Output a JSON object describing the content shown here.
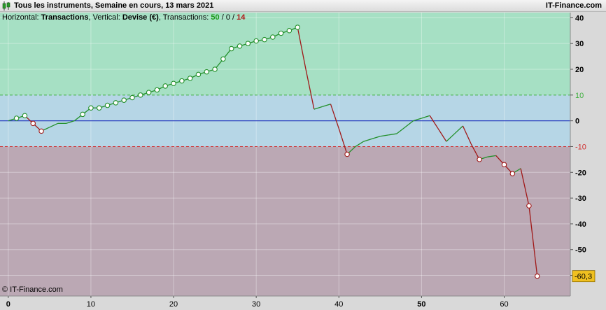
{
  "header": {
    "title": "Tous les instruments, Semaine en cours, 13 mars 2021",
    "brand": "IT-Finance.com"
  },
  "subtitle": {
    "horizontal_label": "Horizontal:",
    "horizontal_value": "Transactions",
    "vertical_label": "Vertical:",
    "vertical_value": "Devise (€)",
    "transactions_label": "Transactions:",
    "count_win": "50",
    "count_neutral": "0",
    "count_loss": "14",
    "sep": "/"
  },
  "footer": {
    "credit": "© IT-Finance.com"
  },
  "colors": {
    "profit_zone": "#a6e0c4",
    "neutral_zone": "#b6d6e6",
    "loss_zone": "#bba8b4",
    "win_line": "#22902a",
    "loss_line": "#a01818",
    "zero_line": "#2a3fc0",
    "upper_threshold": "#40b040",
    "lower_threshold": "#d03030",
    "last_value_badge": "#f0c020"
  },
  "chart_data": {
    "type": "line",
    "xlabel": "Transactions",
    "ylabel": "Devise (€)",
    "xlim": [
      -1,
      68
    ],
    "ylim": [
      -68,
      42
    ],
    "x_ticks": [
      0,
      10,
      20,
      30,
      40,
      50,
      60
    ],
    "x_ticks_bold": [
      0,
      50
    ],
    "y_ticks": [
      40,
      30,
      20,
      10,
      0,
      -10,
      -20,
      -30,
      -40,
      -50,
      -60
    ],
    "threshold_upper": 10,
    "threshold_lower": -10,
    "upper_threshold_label": "10",
    "lower_threshold_label": "-10",
    "last_value_label": "-60,3",
    "series": [
      {
        "x": [
          0,
          1,
          2,
          3,
          4,
          5,
          6,
          7,
          8,
          9,
          10,
          11,
          12,
          13,
          14,
          15,
          16,
          17,
          18,
          19,
          20,
          21,
          22,
          23,
          24,
          25,
          26,
          27,
          28,
          29,
          30,
          31,
          32,
          33,
          34,
          35,
          36,
          37,
          38,
          39,
          40,
          41,
          42,
          43,
          44,
          45,
          46,
          47,
          48,
          49,
          50,
          51,
          52,
          53,
          54,
          55,
          56,
          57,
          58,
          59,
          60,
          61,
          62,
          63,
          64
        ],
        "y": [
          0,
          1,
          2,
          -1,
          -4,
          -2.5,
          -1,
          -1,
          0,
          2.5,
          5,
          5,
          6,
          7,
          8,
          9,
          10,
          11,
          12,
          13.5,
          14.5,
          15.5,
          16.5,
          18,
          19,
          20,
          24,
          28,
          29,
          30,
          31,
          31.5,
          32.5,
          34,
          35,
          36.3,
          20,
          4.5,
          5.5,
          6.5,
          -3,
          -13,
          -10,
          -8,
          -7,
          -6,
          -5.5,
          -5,
          -2.5,
          0,
          1,
          2,
          -3,
          -8,
          -5,
          -2,
          -9,
          -15,
          -14,
          -13.5,
          -17,
          -20.5,
          -18.5,
          -33,
          -60.3
        ],
        "markers": [
          1,
          2,
          3,
          4,
          9,
          10,
          11,
          12,
          13,
          14,
          15,
          16,
          17,
          18,
          19,
          20,
          21,
          22,
          23,
          24,
          25,
          26,
          27,
          28,
          29,
          30,
          31,
          32,
          33,
          34,
          35,
          41,
          57,
          60,
          61,
          63,
          64
        ]
      }
    ]
  }
}
